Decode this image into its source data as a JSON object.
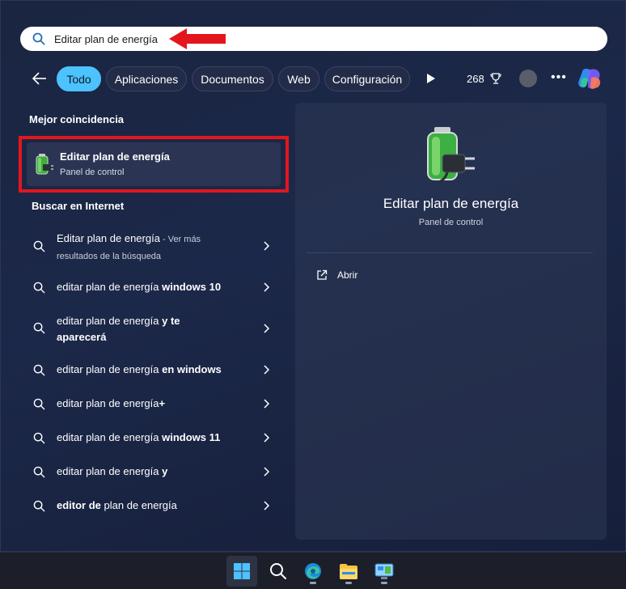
{
  "search": {
    "query": "Editar plan de energía",
    "icon": "search-icon"
  },
  "filters": {
    "back_icon": "arrow-left-icon",
    "chips": [
      "Todo",
      "Aplicaciones",
      "Documentos",
      "Web",
      "Configuración"
    ],
    "active": "Todo",
    "points": "268",
    "points_icon": "trophy-icon",
    "more_label": "•••"
  },
  "best_match": {
    "heading": "Mejor coincidencia",
    "title": "Editar plan de energía",
    "subtitle": "Panel de control",
    "icon": "battery-plug-icon"
  },
  "web": {
    "heading": "Buscar en Internet",
    "results": [
      {
        "plain": "Editar plan de energía",
        "muted": " - Ver más resultados de la búsqueda",
        "bold": ""
      },
      {
        "plain": "editar plan de energía ",
        "bold": "windows 10"
      },
      {
        "plain": "editar plan de energía ",
        "bold": "y te aparecerá"
      },
      {
        "plain": "editar plan de energía ",
        "bold": "en windows"
      },
      {
        "plain": "editar plan de energía",
        "bold": "+"
      },
      {
        "plain": "editar plan de energía ",
        "bold": "windows 11"
      },
      {
        "plain": "editar plan de energía ",
        "bold": "y"
      },
      {
        "plain": "",
        "bold": "editor de",
        "plain2": " plan de energía"
      }
    ]
  },
  "detail": {
    "title": "Editar plan de energía",
    "subtitle": "Panel de control",
    "open_label": "Abrir",
    "open_icon": "open-external-icon"
  },
  "taskbar": {
    "items": [
      "windows-start-icon",
      "search-icon",
      "edge-browser-icon",
      "file-explorer-icon",
      "control-panel-icon"
    ]
  },
  "colors": {
    "accent": "#4cc2ff",
    "highlight_red": "#e3161d",
    "panel_bg": "#1c2849"
  }
}
